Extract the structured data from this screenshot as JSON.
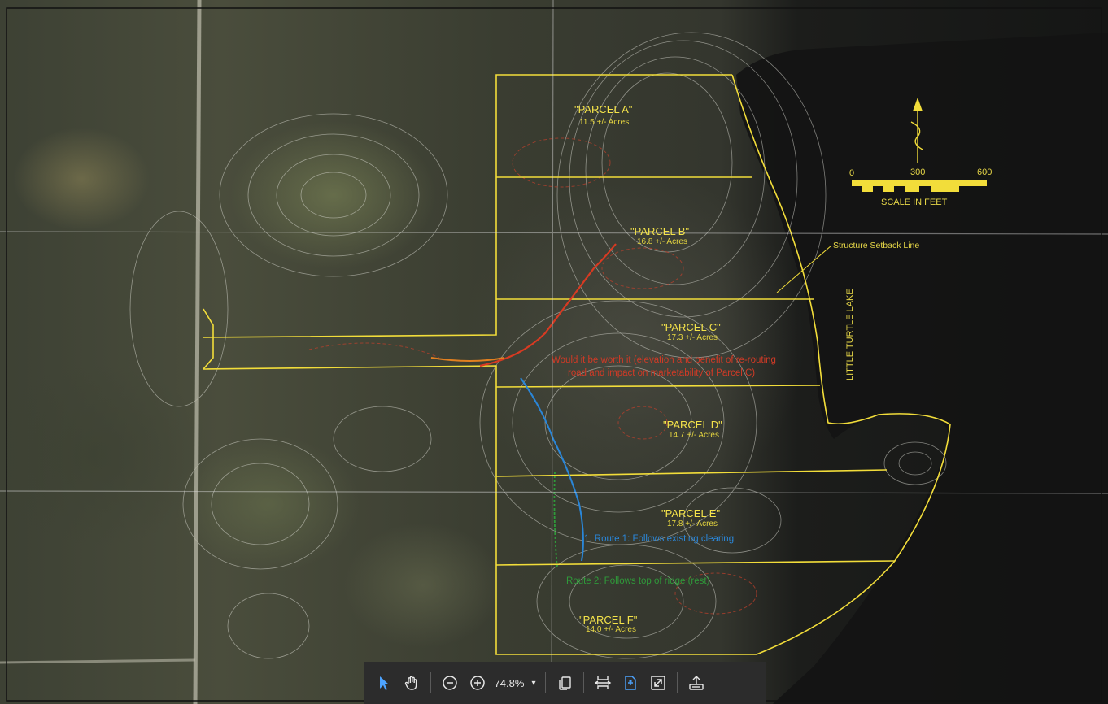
{
  "map": {
    "parcels": [
      {
        "name": "\"PARCEL A\"",
        "acres": "11.5 +/- Acres"
      },
      {
        "name": "\"PARCEL B\"",
        "acres": "16.8 +/- Acres"
      },
      {
        "name": "\"PARCEL C\"",
        "acres": "17.3 +/- Acres"
      },
      {
        "name": "\"PARCEL D\"",
        "acres": "14.7 +/- Acres"
      },
      {
        "name": "\"PARCEL E\"",
        "acres": "17.8 +/- Acres"
      },
      {
        "name": "\"PARCEL F\"",
        "acres": "14.0 +/- Acres"
      }
    ],
    "notes": {
      "red_line1": "Would it be worth it (elevation and benefit of re-routing",
      "red_line2": "road and impact on marketability of Parcel C)",
      "blue": "1. Route 1: Follows existing clearing",
      "green": "Route 2: Follows top of ridge (rest)"
    },
    "labels": {
      "setback": "Structure Setback Line",
      "lake": "LITTLE TURTLE LAKE",
      "scale_title": "SCALE IN FEET",
      "scale_0": "0",
      "scale_300": "300",
      "scale_600": "600"
    },
    "colors": {
      "parcel_lines": "#f2dd3a",
      "red_route": "#d83a22",
      "blue_route": "#2a86d8",
      "green_route": "#2f9a3a",
      "contours": "#d8d8d0"
    }
  },
  "toolbar": {
    "zoom": "74.8%",
    "zoom_caret": "▾"
  }
}
